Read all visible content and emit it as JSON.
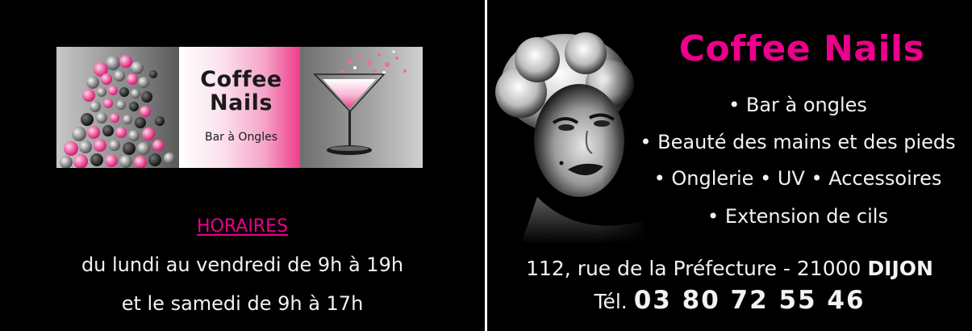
{
  "left_card": {
    "logo": {
      "title_line_1": "Coffee",
      "title_line_2": "Nails",
      "subtitle": "Bar à Ongles"
    },
    "hours": {
      "title": "HORAIRES",
      "weekdays": "du lundi au vendredi de 9h à 19h",
      "saturday": "et le samedi de 9h à 17h"
    }
  },
  "right_card": {
    "name": "Coffee Nails",
    "services": [
      "• Bar à ongles",
      "• Beauté des mains et des pieds",
      "• Onglerie • UV • Accessoires",
      "• Extension de cils"
    ],
    "address": "112, rue de la Préfecture - 21000",
    "city": "DIJON",
    "phone_label": "Tél.",
    "phone_number": "03 80 72 55 46"
  },
  "colors": {
    "background": "#000000",
    "accent_pink": "#ec008c",
    "text_light": "#f2f2f2"
  },
  "icons": [
    "marilyn-portrait-image",
    "martini-glass-icon",
    "dotted-portrait-image"
  ]
}
